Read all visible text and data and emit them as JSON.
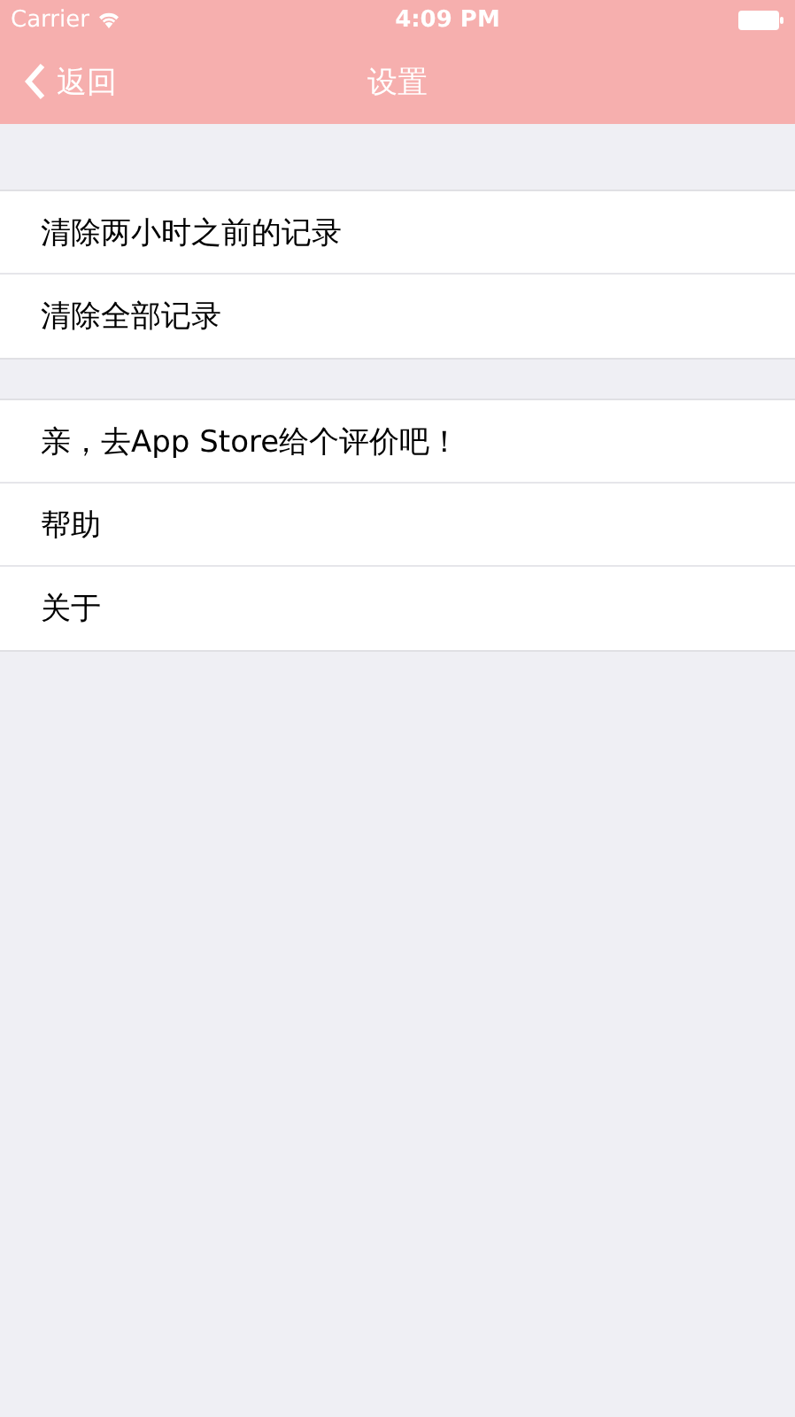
{
  "status_bar": {
    "carrier": "Carrier",
    "time": "4:09 PM"
  },
  "nav_bar": {
    "back": "返回",
    "title": "设置"
  },
  "sections": [
    {
      "items": [
        "清除两小时之前的记录",
        "清除全部记录"
      ]
    },
    {
      "items": [
        "亲，去App Store给个评价吧！",
        "帮助",
        "关于"
      ]
    }
  ]
}
